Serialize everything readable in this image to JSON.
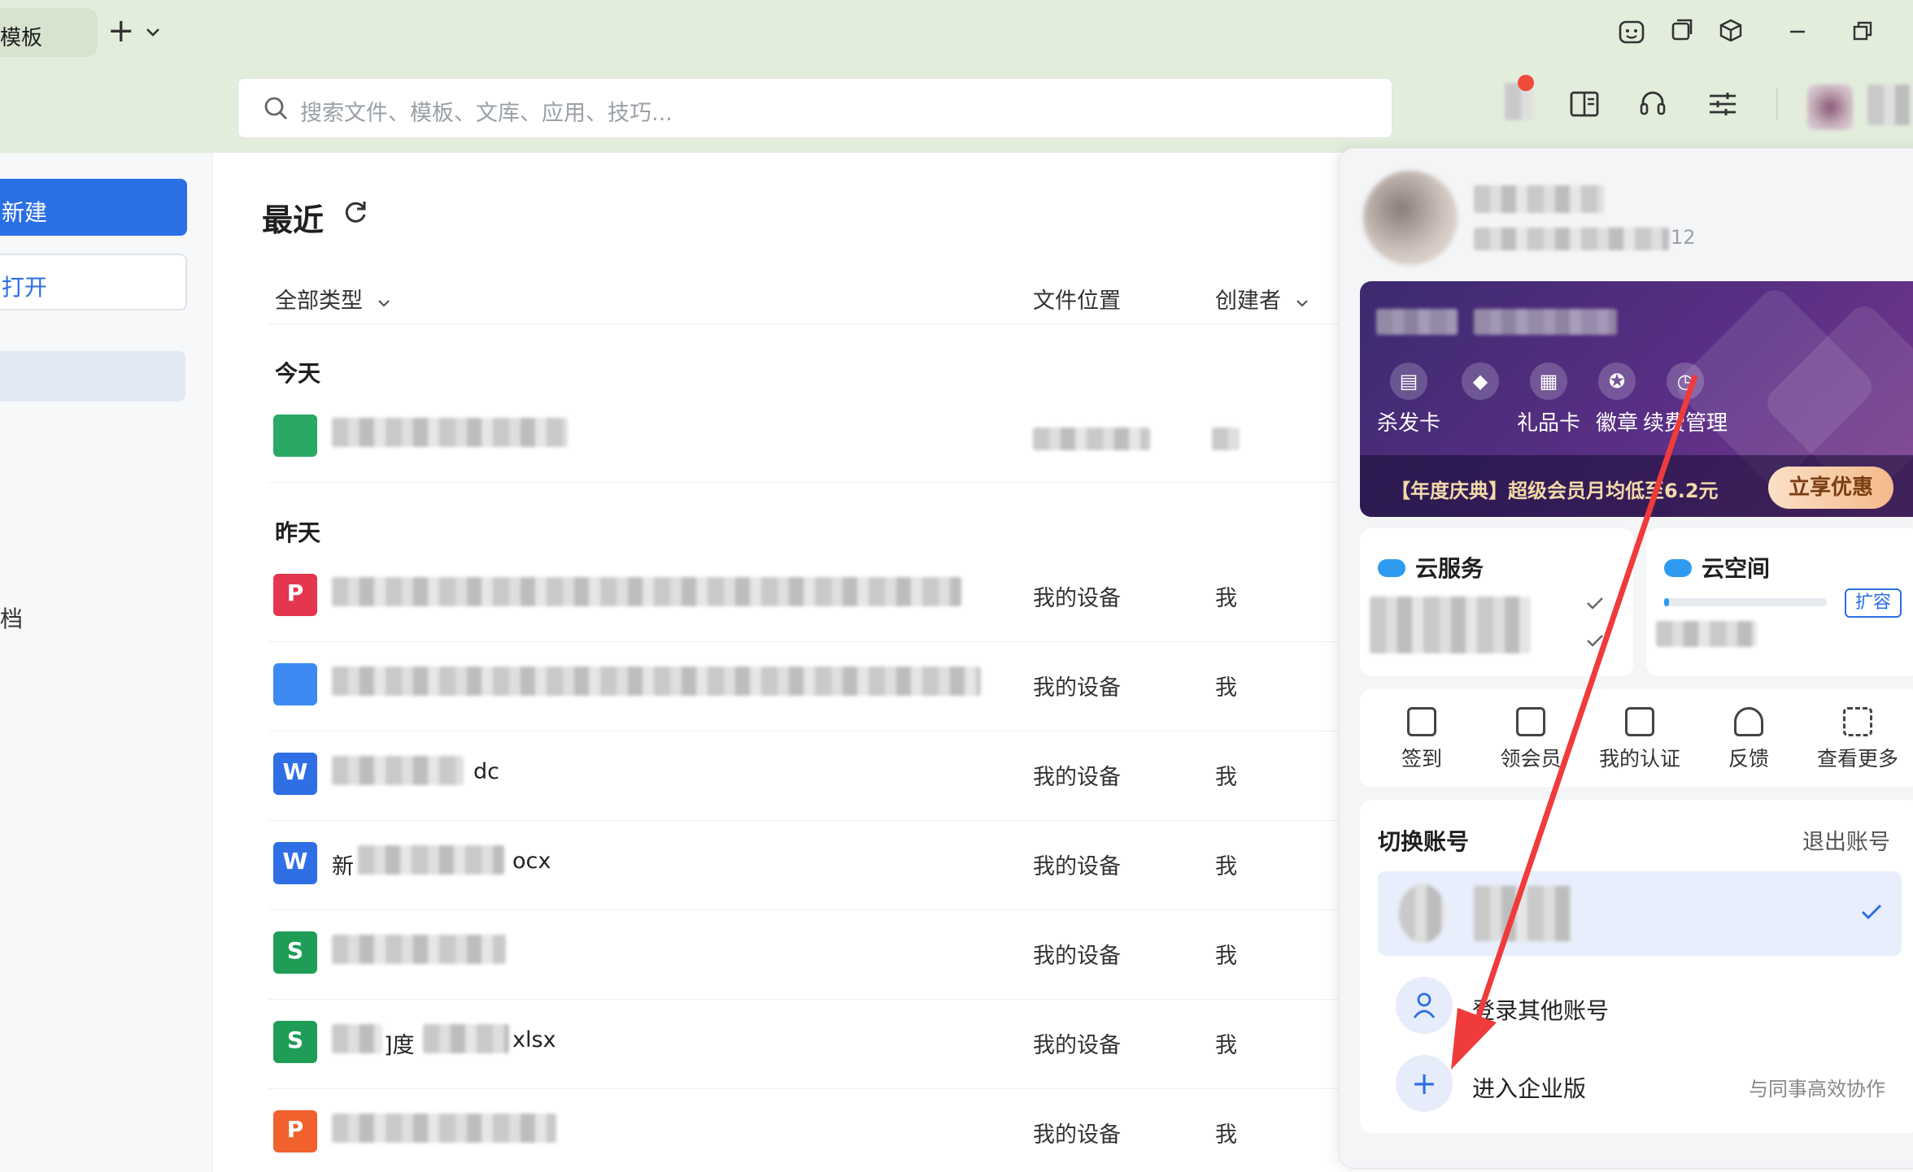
{
  "tabs": {
    "active_tab_label": "模板",
    "new_tab_symbol": "+",
    "dropdown_symbol": "⌄"
  },
  "search": {
    "placeholder": "搜索文件、模板、文库、应用、技巧..."
  },
  "sidebar": {
    "new_label": "新建",
    "open_label": "打开",
    "partial_item_label": "档"
  },
  "recent": {
    "title": "最近",
    "columns": {
      "type_filter": "全部类型",
      "location": "文件位置",
      "creator": "创建者"
    },
    "groups": [
      {
        "label": "今天",
        "rows": [
          {
            "icon": "",
            "icon_color": "#2aa866",
            "name_text": "",
            "location": "",
            "creator": ""
          }
        ]
      },
      {
        "label": "昨天",
        "rows": [
          {
            "icon": "P",
            "icon_color": "#e5364f",
            "name_text": "",
            "location": "我的设备",
            "creator": "我"
          },
          {
            "icon": "",
            "icon_color": "#3d8bf2",
            "name_text": "",
            "location": "我的设备",
            "creator": "我"
          },
          {
            "icon": "W",
            "icon_color": "#2f6fe6",
            "name_text": "dc",
            "location": "我的设备",
            "creator": "我"
          },
          {
            "icon": "W",
            "icon_color": "#2f6fe6",
            "name_text": "新",
            "name_suffix": "ocx",
            "location": "我的设备",
            "creator": "我"
          },
          {
            "icon": "S",
            "icon_color": "#1f9d57",
            "name_text": "",
            "location": "我的设备",
            "creator": "我"
          },
          {
            "icon": "S",
            "icon_color": "#1f9d57",
            "name_text": "]度",
            "name_suffix": "xlsx",
            "location": "我的设备",
            "creator": "我"
          },
          {
            "icon": "P",
            "icon_color": "#f0612e",
            "name_text": "",
            "location": "我的设备",
            "creator": "我"
          }
        ]
      }
    ]
  },
  "account_panel": {
    "user_id_partial": "12",
    "vip": {
      "items": [
        "杀发卡",
        "",
        "礼品卡",
        "徽章",
        "续费管理"
      ],
      "promo": "【年度庆典】超级会员月均低至6.2元",
      "cta": "立享优惠"
    },
    "cloud_service": {
      "title": "云服务"
    },
    "cloud_space": {
      "title": "云空间",
      "expand": "扩容"
    },
    "quick_actions": [
      "签到",
      "领会员",
      "我的认证",
      "反馈",
      "查看更多"
    ],
    "switch_account": {
      "title": "切换账号",
      "logout": "退出账号",
      "login_other": "登录其他账号",
      "enterprise": "进入企业版",
      "enterprise_desc": "与同事高效协作"
    }
  },
  "colors": {
    "accent": "#2b6fe5",
    "annotation_arrow": "#ef3b3b",
    "topbar_bg": "#e3eddc"
  }
}
